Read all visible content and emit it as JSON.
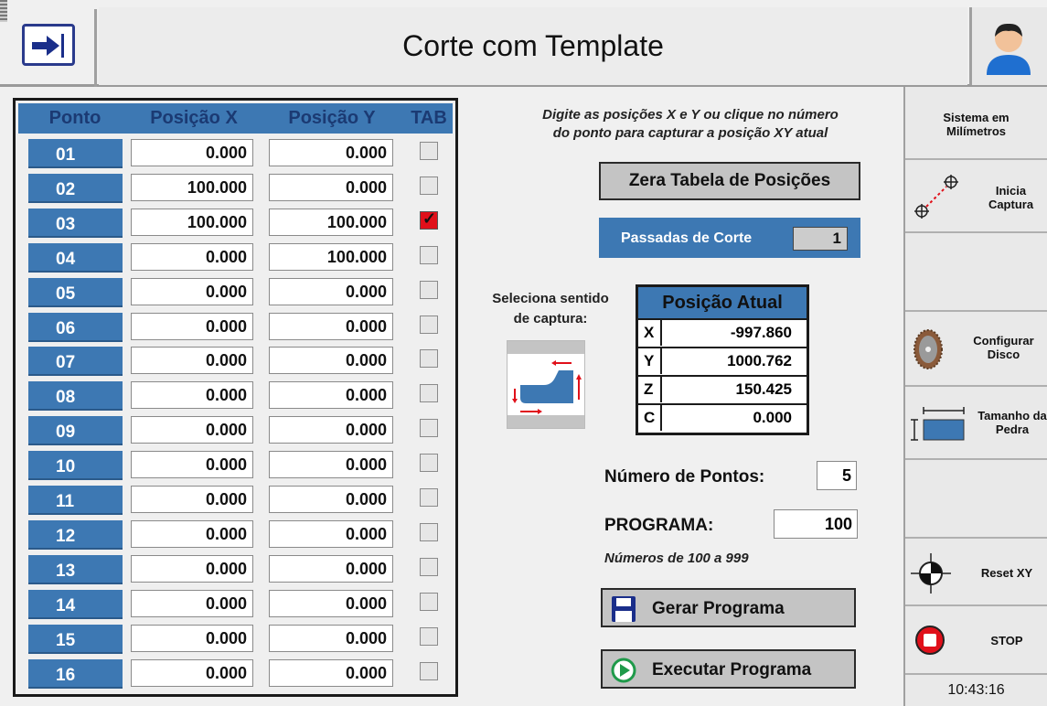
{
  "header": {
    "title": "Corte com Template",
    "exit_icon": "exit-arrow-icon",
    "user_icon": "user-avatar-icon"
  },
  "table": {
    "headers": {
      "point": "Ponto",
      "x": "Posição X",
      "y": "Posição Y",
      "tab": "TAB"
    },
    "rows": [
      {
        "point": "01",
        "x": "0.000",
        "y": "0.000",
        "tab": false
      },
      {
        "point": "02",
        "x": "100.000",
        "y": "0.000",
        "tab": false
      },
      {
        "point": "03",
        "x": "100.000",
        "y": "100.000",
        "tab": true
      },
      {
        "point": "04",
        "x": "0.000",
        "y": "100.000",
        "tab": false
      },
      {
        "point": "05",
        "x": "0.000",
        "y": "0.000",
        "tab": false
      },
      {
        "point": "06",
        "x": "0.000",
        "y": "0.000",
        "tab": false
      },
      {
        "point": "07",
        "x": "0.000",
        "y": "0.000",
        "tab": false
      },
      {
        "point": "08",
        "x": "0.000",
        "y": "0.000",
        "tab": false
      },
      {
        "point": "09",
        "x": "0.000",
        "y": "0.000",
        "tab": false
      },
      {
        "point": "10",
        "x": "0.000",
        "y": "0.000",
        "tab": false
      },
      {
        "point": "11",
        "x": "0.000",
        "y": "0.000",
        "tab": false
      },
      {
        "point": "12",
        "x": "0.000",
        "y": "0.000",
        "tab": false
      },
      {
        "point": "13",
        "x": "0.000",
        "y": "0.000",
        "tab": false
      },
      {
        "point": "14",
        "x": "0.000",
        "y": "0.000",
        "tab": false
      },
      {
        "point": "15",
        "x": "0.000",
        "y": "0.000",
        "tab": false
      },
      {
        "point": "16",
        "x": "0.000",
        "y": "0.000",
        "tab": false
      }
    ]
  },
  "panel": {
    "instruction_line1": "Digite as posições X e Y ou clique no número",
    "instruction_line2": "do ponto para capturar a posição XY atual",
    "reset_table_label": "Zera Tabela de Posições",
    "passes_label": "Passadas de Corte",
    "passes_value": "1",
    "capture_direction_line1": "Seleciona sentido",
    "capture_direction_line2": "de captura:",
    "current_position": {
      "title": "Posição Atual",
      "rows": [
        {
          "axis": "X",
          "value": "-997.860"
        },
        {
          "axis": "Y",
          "value": "1000.762"
        },
        {
          "axis": "Z",
          "value": "150.425"
        },
        {
          "axis": "C",
          "value": "0.000"
        }
      ]
    },
    "num_points_label": "Número de Pontos:",
    "num_points_value": "5",
    "program_label": "PROGRAMA:",
    "program_value": "100",
    "program_hint": "Números de 100 a 999",
    "generate_label": "Gerar Programa",
    "execute_label": "Executar Programa"
  },
  "sidebar": {
    "units_line1": "Sistema em",
    "units_line2": "Milímetros",
    "capture_line1": "Inicia",
    "capture_line2": "Captura",
    "disc_line1": "Configurar",
    "disc_line2": "Disco",
    "stone_line1": "Tamanho da",
    "stone_line2": "Pedra",
    "reset_xy": "Reset XY",
    "stop": "STOP",
    "clock": "10:43:16"
  },
  "colors": {
    "accent_blue": "#3d78b3",
    "checkbox_checked": "#e0101a",
    "button_gray": "#c4c4c4"
  }
}
